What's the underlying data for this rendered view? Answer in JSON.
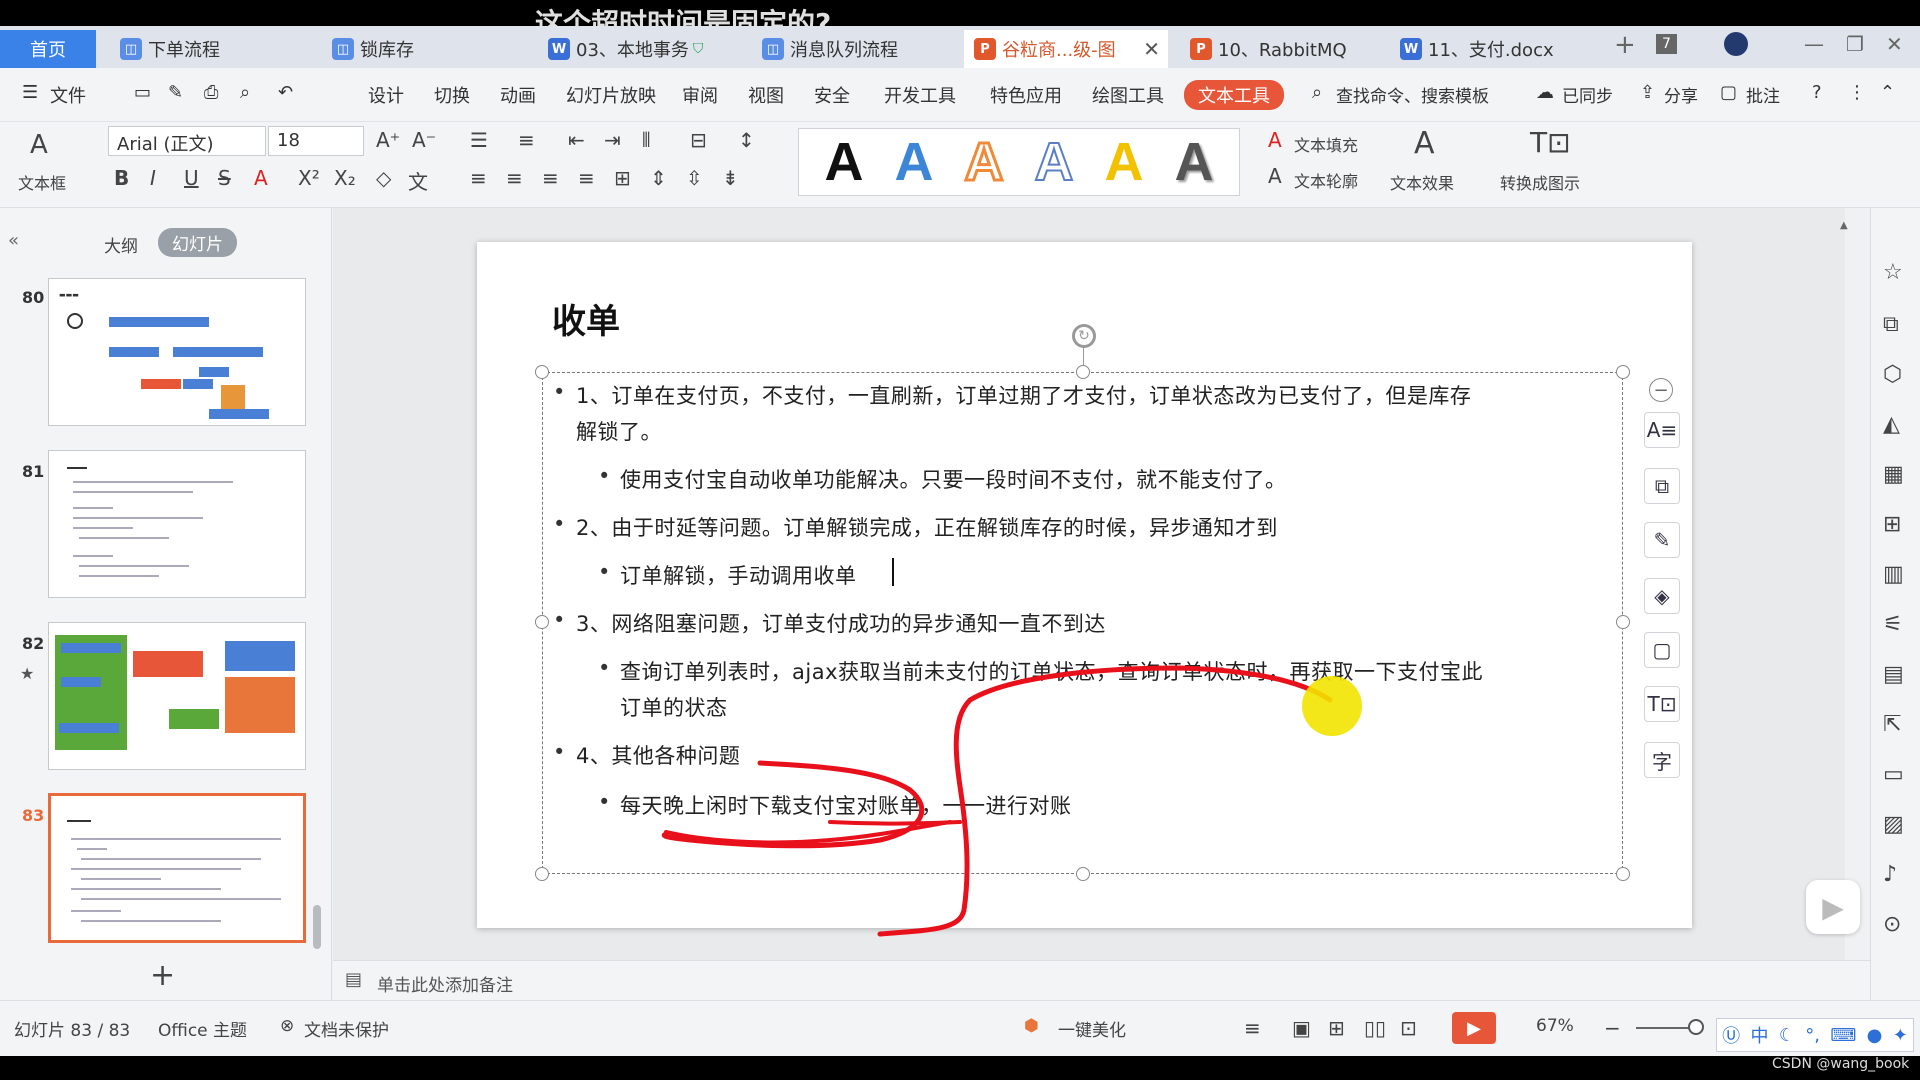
{
  "video_caption": "这个超时时间是固定的?",
  "tabs": [
    {
      "label": "首页",
      "type": "home"
    },
    {
      "label": "下单流程",
      "icon": "diagram"
    },
    {
      "label": "锁库存",
      "icon": "diagram"
    },
    {
      "label": "03、本地事务",
      "icon": "word"
    },
    {
      "label": "消息队列流程",
      "icon": "diagram"
    },
    {
      "label": "谷粒商...级-图",
      "icon": "ppt",
      "active": true
    },
    {
      "label": "10、RabbitMQ",
      "icon": "ppt"
    },
    {
      "label": "11、支付.docx",
      "icon": "word"
    }
  ],
  "tab_count": "7",
  "menu": {
    "file": "文件",
    "items": [
      "设计",
      "切换",
      "动画",
      "幻灯片放映",
      "审阅",
      "视图",
      "安全",
      "开发工具",
      "特色应用",
      "绘图工具"
    ],
    "active_tool": "文本工具",
    "search": "查找命令、搜索模板",
    "sync": "已同步",
    "share": "分享",
    "comment": "批注"
  },
  "ribbon": {
    "textbox": "文本框",
    "font_name": "Arial (正文)",
    "font_size": "18",
    "art_letter": "A",
    "art_colors": [
      "#111111",
      "#3b86d6",
      "#ef8a3a",
      "#5b7fc7",
      "#f2c200",
      "#555555"
    ],
    "text_fill": "文本填充",
    "text_outline": "文本轮廓",
    "text_effect": "文本效果",
    "convert": "转换成图示"
  },
  "left_panel": {
    "tab_outline": "大纲",
    "tab_slides": "幻灯片",
    "thumbs": [
      {
        "num": "80"
      },
      {
        "num": "81"
      },
      {
        "num": "82"
      },
      {
        "num": "83",
        "selected": true
      }
    ],
    "add": "+"
  },
  "slide": {
    "title": "收单",
    "bullets": [
      {
        "level": 1,
        "text": "1、订单在支付页，不支付，一直刷新，订单过期了才支付，订单状态改为已支付了，但是库存"
      },
      {
        "level": 0,
        "text": "解锁了。"
      },
      {
        "level": 2,
        "text": "使用支付宝自动收单功能解决。只要一段时间不支付，就不能支付了。"
      },
      {
        "level": 1,
        "text": "2、由于时延等问题。订单解锁完成，正在解锁库存的时候，异步通知才到"
      },
      {
        "level": 2,
        "text": "订单解锁，手动调用收单"
      },
      {
        "level": 1,
        "text": "3、网络阻塞问题，订单支付成功的异步通知一直不到达"
      },
      {
        "level": 2,
        "text": "查询订单列表时，ajax获取当前未支付的订单状态，查询订单状态时，再获取一下支付宝此"
      },
      {
        "level": 3,
        "text": "订单的状态"
      },
      {
        "level": 1,
        "text": "4、其他各种问题"
      },
      {
        "level": 2,
        "text": "每天晚上闲时下载支付宝对账单，一一进行对账"
      }
    ]
  },
  "notes_placeholder": "单击此处添加备注",
  "status": {
    "slide_count": "幻灯片 83 / 83",
    "theme": "Office 主题",
    "protect": "文档未保护",
    "beautify": "一键美化",
    "zoom": "67%"
  },
  "ime": {
    "label": "中"
  },
  "watermark": "CSDN @wang_book"
}
